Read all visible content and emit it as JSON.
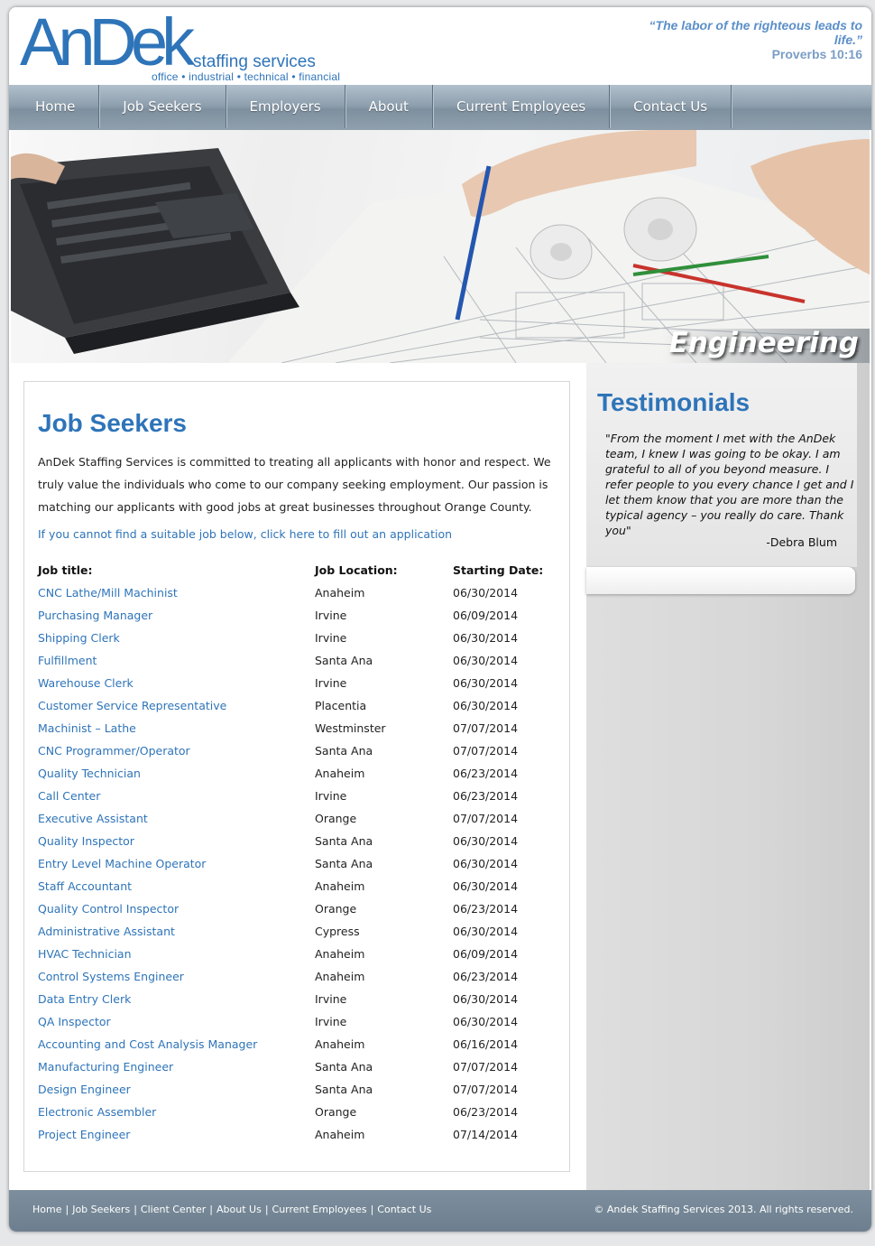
{
  "header": {
    "logo_main": "AnDek",
    "logo_staffing": "staffing services",
    "logo_tagline": "office • industrial • technical • financial",
    "quote_text": "“The labor of the righteous leads to life.”",
    "quote_ref": "Proverbs 10:16"
  },
  "nav": {
    "items": [
      "Home",
      "Job Seekers",
      "Employers",
      "About",
      "Current Employees",
      "Contact Us"
    ]
  },
  "banner": {
    "caption": "Engineering"
  },
  "main": {
    "title": "Job Seekers",
    "intro": "AnDek Staffing Services is committed to treating all applicants with honor and respect. We truly value the individuals who come to our company seeking employment. Our passion is matching our applicants with good jobs at great businesses throughout Orange County.",
    "apply_link": "If you cannot find a suitable job below, click here to fill out an application",
    "table": {
      "headers": [
        "Job title:",
        "Job Location:",
        "Starting Date:"
      ],
      "rows": [
        [
          "CNC Lathe/Mill Machinist",
          "Anaheim",
          "06/30/2014"
        ],
        [
          "Purchasing Manager",
          "Irvine",
          "06/09/2014"
        ],
        [
          "Shipping Clerk",
          "Irvine",
          "06/30/2014"
        ],
        [
          "Fulfillment",
          "Santa Ana",
          "06/30/2014"
        ],
        [
          "Warehouse Clerk",
          "Irvine",
          "06/30/2014"
        ],
        [
          "Customer Service Representative",
          "Placentia",
          "06/30/2014"
        ],
        [
          "Machinist – Lathe",
          "Westminster",
          "07/07/2014"
        ],
        [
          "CNC Programmer/Operator",
          "Santa Ana",
          "07/07/2014"
        ],
        [
          "Quality Technician",
          "Anaheim",
          "06/23/2014"
        ],
        [
          "Call Center",
          "Irvine",
          "06/23/2014"
        ],
        [
          "Executive Assistant",
          "Orange",
          "07/07/2014"
        ],
        [
          "Quality Inspector",
          "Santa Ana",
          "06/30/2014"
        ],
        [
          "Entry Level Machine Operator",
          "Santa Ana",
          "06/30/2014"
        ],
        [
          "Staff Accountant",
          "Anaheim",
          "06/30/2014"
        ],
        [
          "Quality Control Inspector",
          "Orange",
          "06/23/2014"
        ],
        [
          "Administrative Assistant",
          "Cypress",
          "06/30/2014"
        ],
        [
          "HVAC Technician",
          "Anaheim",
          "06/09/2014"
        ],
        [
          "Control Systems Engineer",
          "Anaheim",
          "06/23/2014"
        ],
        [
          "Data Entry Clerk",
          "Irvine",
          "06/30/2014"
        ],
        [
          "QA Inspector",
          "Irvine",
          "06/30/2014"
        ],
        [
          "Accounting and Cost Analysis Manager",
          "Anaheim",
          "06/16/2014"
        ],
        [
          "Manufacturing Engineer",
          "Santa Ana",
          "07/07/2014"
        ],
        [
          "Design Engineer",
          "Santa Ana",
          "07/07/2014"
        ],
        [
          "Electronic Assembler",
          "Orange",
          "06/23/2014"
        ],
        [
          "Project Engineer",
          "Anaheim",
          "07/14/2014"
        ]
      ]
    }
  },
  "sidebar": {
    "title": "Testimonials",
    "testimonial": "\"From the moment I met with the AnDek team, I knew I was going to be okay. I am grateful to all of you beyond measure. I refer people to you every chance I get and I let them know that you are more than the typical agency – you really do care. Thank you\"",
    "author": "-Debra Blum"
  },
  "footer": {
    "links": [
      "Home",
      "Job Seekers",
      "Client Center",
      "About Us",
      "Current Employees",
      "Contact Us"
    ],
    "copyright": "© Andek Staffing Services 2013. All rights reserved."
  },
  "colors": {
    "brand_blue": "#2e74b9",
    "nav_gray": "#8e9fae",
    "footer_gray": "#6d7f8e"
  }
}
